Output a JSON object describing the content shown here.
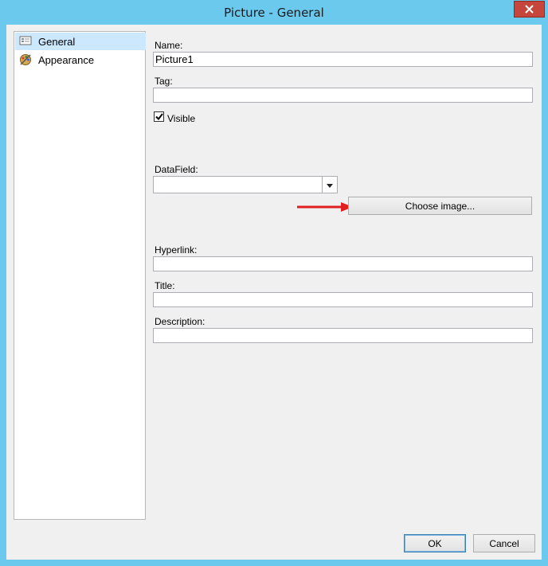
{
  "window": {
    "title": "Picture - General"
  },
  "sidebar": {
    "items": [
      {
        "label": "General",
        "icon": "general-page-icon",
        "selected": true
      },
      {
        "label": "Appearance",
        "icon": "appearance-palette-icon",
        "selected": false
      }
    ]
  },
  "form": {
    "name_label": "Name:",
    "name_value": "Picture1",
    "tag_label": "Tag:",
    "tag_value": "",
    "visible_label": "Visible",
    "visible_checked": true,
    "datafield_label": "DataField:",
    "datafield_value": "",
    "choose_image_label": "Choose image...",
    "hyperlink_label": "Hyperlink:",
    "hyperlink_value": "",
    "title_label": "Title:",
    "title_value": "",
    "description_label": "Description:",
    "description_value": ""
  },
  "footer": {
    "ok_label": "OK",
    "cancel_label": "Cancel"
  },
  "colors": {
    "titlebar": "#6cc9ee",
    "close": "#c7463b",
    "selection": "#cce8ff",
    "annotation_arrow": "#e02020"
  }
}
